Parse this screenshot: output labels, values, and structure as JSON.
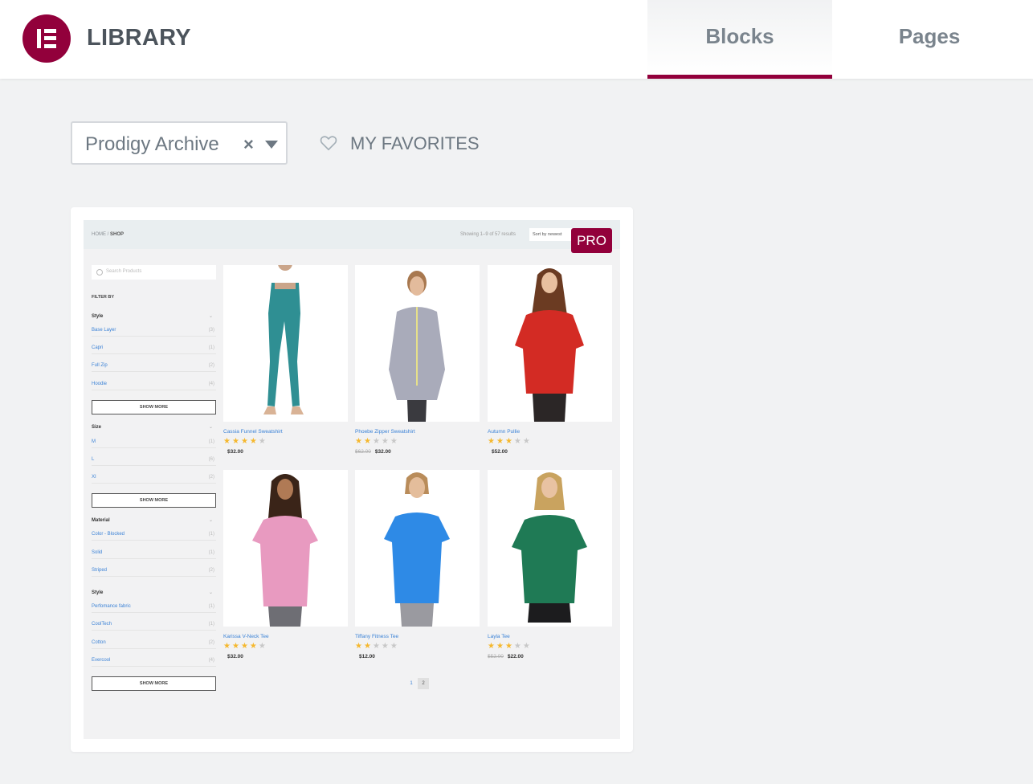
{
  "header": {
    "title": "LIBRARY",
    "tabs": [
      {
        "label": "Blocks",
        "active": true
      },
      {
        "label": "Pages",
        "active": false
      }
    ],
    "accent_color": "#92003b"
  },
  "toolbar": {
    "select_value": "Prodigy Archive",
    "clear_symbol": "×",
    "favorites_label": "MY FAVORITES"
  },
  "card": {
    "badge": "PRO",
    "preview": {
      "breadcrumb_home": "HOME",
      "breadcrumb_sep": "/",
      "breadcrumb_current": "SHOP",
      "showing": "Showing 1–9 of 57 results",
      "sort": "Sort by newest",
      "search_placeholder": "Search Products",
      "filter_by": "FILTER BY",
      "groups": [
        {
          "name": "Style",
          "items": [
            {
              "label": "Base Layer",
              "count": "(3)"
            },
            {
              "label": "Capri",
              "count": "(1)"
            },
            {
              "label": "Full Zip",
              "count": "(2)"
            },
            {
              "label": "Hoodie",
              "count": "(4)"
            }
          ],
          "button": "SHOW MORE"
        },
        {
          "name": "Size",
          "items": [
            {
              "label": "M",
              "count": "(1)"
            },
            {
              "label": "L",
              "count": "(6)"
            },
            {
              "label": "XI",
              "count": "(2)"
            }
          ],
          "button": "SHOW MORE"
        },
        {
          "name": "Material",
          "items": [
            {
              "label": "Color - Blocked",
              "count": "(1)"
            },
            {
              "label": "Solid",
              "count": "(1)"
            },
            {
              "label": "Striped",
              "count": "(2)"
            }
          ]
        },
        {
          "name": "Style",
          "items": [
            {
              "label": "Perfomance fabric",
              "count": "(1)"
            },
            {
              "label": "CoolTech",
              "count": "(1)"
            },
            {
              "label": "Cotton",
              "count": "(2)"
            },
            {
              "label": "Evercool",
              "count": "(4)"
            }
          ],
          "button": "SHOW MORE"
        }
      ],
      "products": [
        {
          "name": "Cassia Funnel Sweatshirt",
          "rating": 4,
          "old_price": "",
          "price": "$32.00",
          "color": "#2f8f93"
        },
        {
          "name": "Phoebe Zipper Sweatshirt",
          "rating": 2,
          "old_price": "$62.00",
          "price": "$32.00",
          "color": "#a9abba"
        },
        {
          "name": "Autumn Pullie",
          "rating": 3,
          "old_price": "",
          "price": "$52.00",
          "color": "#d32b24"
        },
        {
          "name": "Karissa V-Neck Tee",
          "rating": 4,
          "old_price": "",
          "price": "$32.00",
          "color": "#e89ac0"
        },
        {
          "name": "Tiffany Fitness Tee",
          "rating": 2,
          "old_price": "",
          "price": "$12.00",
          "color": "#2e8ae6"
        },
        {
          "name": "Layla Tee",
          "rating": 3,
          "old_price": "$52.00",
          "price": "$22.00",
          "color": "#1f7a55"
        }
      ],
      "pages": [
        "1",
        "2"
      ]
    }
  }
}
